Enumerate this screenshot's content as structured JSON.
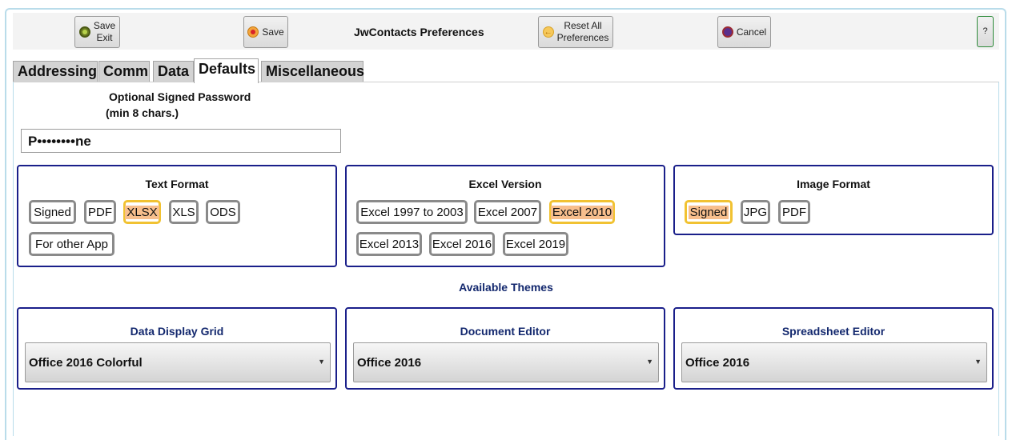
{
  "toolbar": {
    "save_exit_line1": "Save",
    "save_exit_line2": "Exit",
    "save_label": "Save",
    "title": "JwContacts Preferences",
    "reset_line1": "Reset All",
    "reset_line2": "Preferences",
    "cancel_label": "Cancel",
    "help_label": "?"
  },
  "tabs": [
    {
      "label": "Addressing"
    },
    {
      "label": "Comm"
    },
    {
      "label": "Data"
    },
    {
      "label": "Defaults",
      "active": true
    },
    {
      "label": "Miscellaneous"
    }
  ],
  "password": {
    "label_line1": "Optional Signed Password",
    "label_line2": "(min 8 chars.)",
    "value": "P••••••••ne"
  },
  "text_format": {
    "title": "Text Format",
    "options": [
      "Signed",
      "PDF",
      "XLSX",
      "XLS",
      "ODS",
      "For other App"
    ],
    "selected": "XLSX"
  },
  "excel_version": {
    "title": "Excel Version",
    "options": [
      "Excel 1997 to 2003",
      "Excel 2007",
      "Excel 2010",
      "Excel 2013",
      "Excel 2016",
      "Excel 2019"
    ],
    "selected": "Excel 2010"
  },
  "image_format": {
    "title": "Image Format",
    "options": [
      "Signed",
      "JPG",
      "PDF"
    ],
    "selected": "Signed"
  },
  "themes": {
    "heading": "Available Themes",
    "data_grid": {
      "title": "Data Display Grid",
      "value": "Office 2016 Colorful"
    },
    "document_editor": {
      "title": "Document Editor",
      "value": "Office 2016"
    },
    "spreadsheet_editor": {
      "title": "Spreadsheet Editor",
      "value": "Office 2016"
    }
  },
  "icons": {
    "save_exit": "check-circle-icon",
    "save": "save-dot-icon",
    "reset": "back-arrow-icon",
    "cancel": "cancel-dot-icon",
    "dropdown": "chevron-down-icon"
  },
  "colors": {
    "panel_border": "#1a1f8a",
    "selected_border": "#f1c232",
    "selected_fill": "#f8bf8d",
    "theme_text": "#13286e"
  }
}
